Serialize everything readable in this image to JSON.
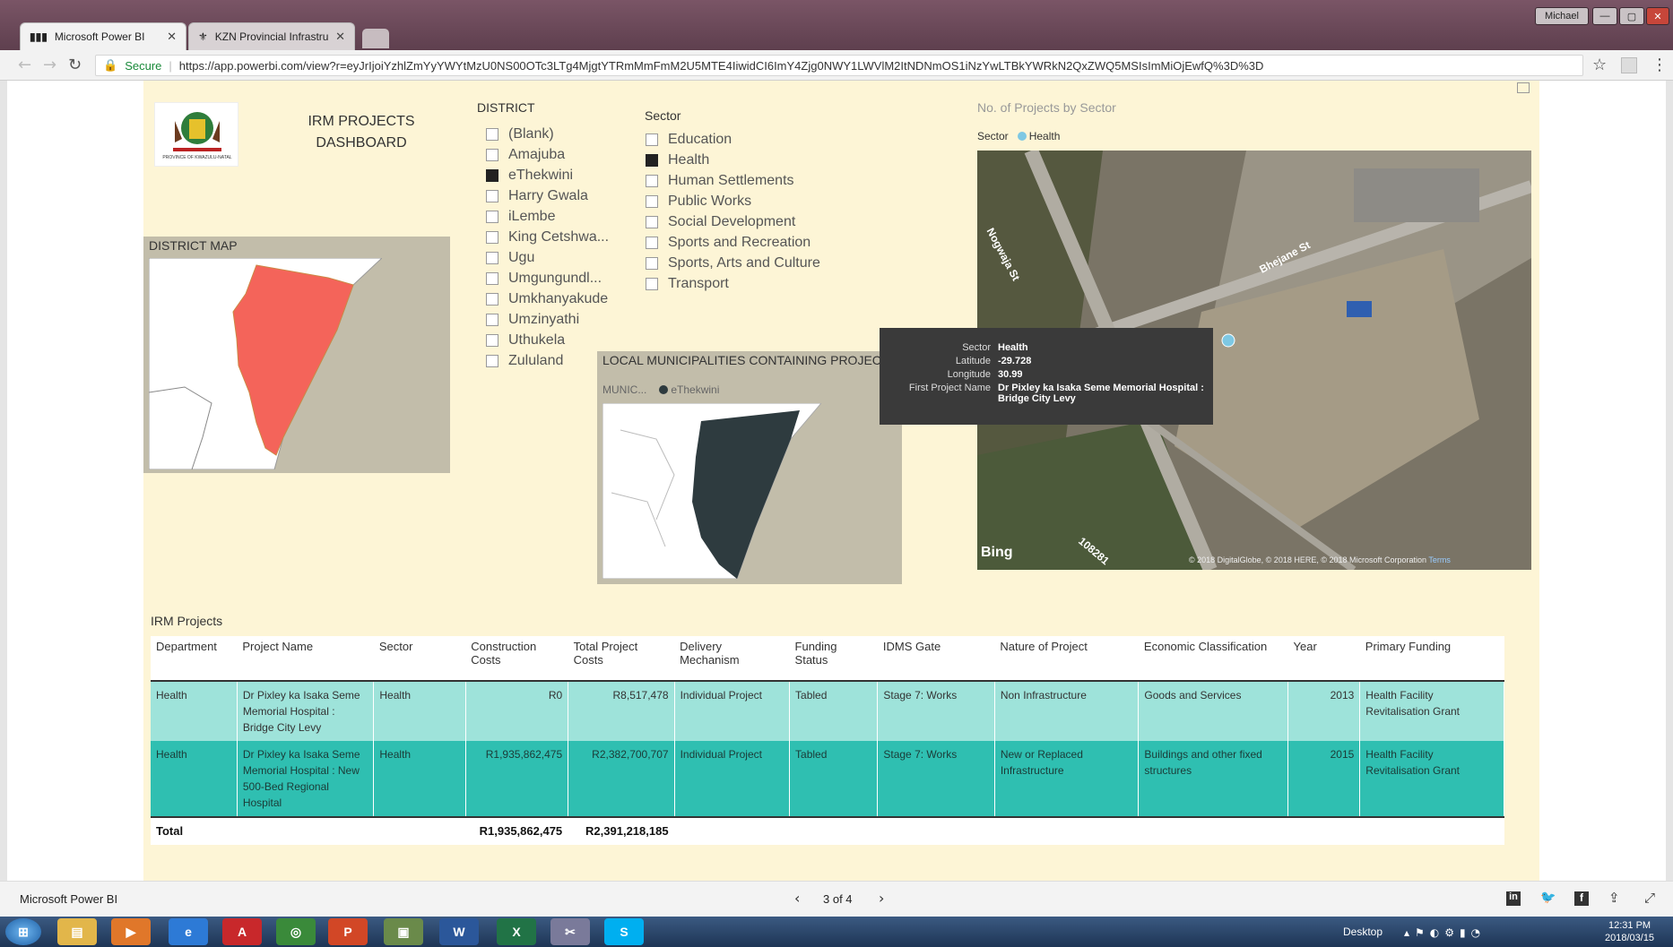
{
  "browser": {
    "tabs": [
      {
        "label": "Microsoft Power BI",
        "active": true
      },
      {
        "label": "KZN Provincial Infrastruc",
        "active": false
      }
    ],
    "user": "Michael",
    "secure_label": "Secure",
    "url": "https://app.powerbi.com/view?r=eyJrIjoiYzhlZmYyYWYtMzU0NS00OTc3LTg4MjgtYTRmMmFmM2U5MTE4IiwidCI6ImY4Zjg0NWY1LWVlM2ItNDNmOS1iNzYwLTBkYWRkN2QxZWQ5MSIsImMiOjEwfQ%3D%3D"
  },
  "dashboard": {
    "title_line1": "IRM PROJECTS",
    "title_line2": "DASHBOARD",
    "logo_text": "PROVINCE OF KWAZULU-NATAL",
    "district": {
      "heading": "DISTRICT",
      "items": [
        {
          "label": "(Blank)",
          "checked": false
        },
        {
          "label": "Amajuba",
          "checked": false
        },
        {
          "label": "eThekwini",
          "checked": true
        },
        {
          "label": "Harry Gwala",
          "checked": false
        },
        {
          "label": "iLembe",
          "checked": false
        },
        {
          "label": "King Cetshwa...",
          "checked": false
        },
        {
          "label": "Ugu",
          "checked": false
        },
        {
          "label": "Umgungundl...",
          "checked": false
        },
        {
          "label": "Umkhanyakude",
          "checked": false
        },
        {
          "label": "Umzinyathi",
          "checked": false
        },
        {
          "label": "Uthukela",
          "checked": false
        },
        {
          "label": "Zululand",
          "checked": false
        }
      ]
    },
    "sector": {
      "heading": "Sector",
      "items": [
        {
          "label": "Education",
          "checked": false
        },
        {
          "label": "Health",
          "checked": true
        },
        {
          "label": "Human Settlements",
          "checked": false
        },
        {
          "label": "Public Works",
          "checked": false
        },
        {
          "label": "Social Development",
          "checked": false
        },
        {
          "label": "Sports and Recreation",
          "checked": false
        },
        {
          "label": "Sports, Arts and Culture",
          "checked": false
        },
        {
          "label": "Transport",
          "checked": false
        }
      ]
    },
    "district_map": {
      "title": "DISTRICT MAP",
      "highlight_color": "#f4645a"
    },
    "muni_map": {
      "title": "LOCAL MUNICIPALITIES CONTAINING PROJECTS",
      "legend_label": "MUNIC...",
      "legend_item": "eThekwini",
      "color": "#2e3b3f"
    },
    "sector_map": {
      "title": "No. of Projects by Sector",
      "legend_label": "Sector",
      "legend_item": "Health",
      "legend_color": "#7ec8e3",
      "streets": [
        "Nogwaja St",
        "Bhejane St",
        "108281"
      ],
      "bing": "Bing",
      "attribution": "© 2018 DigitalGlobe, © 2018 HERE, © 2018 Microsoft Corporation",
      "terms": "Terms"
    },
    "tooltip": {
      "rows": [
        {
          "k": "Sector",
          "v": "Health"
        },
        {
          "k": "Latitude",
          "v": "-29.728"
        },
        {
          "k": "Longitude",
          "v": "30.99"
        },
        {
          "k": "First Project Name",
          "v": "Dr Pixley ka Isaka Seme Memorial Hospital : Bridge City Levy"
        }
      ]
    },
    "table": {
      "title": "IRM Projects",
      "columns": [
        "Department",
        "Project Name",
        "Sector",
        "Construction Costs",
        "Total Project Costs",
        "Delivery Mechanism",
        "Funding Status",
        "IDMS Gate",
        "Nature of Project",
        "Economic Classification",
        "Year",
        "Primary Funding"
      ],
      "rows": [
        [
          "Health",
          "Dr Pixley ka Isaka Seme Memorial Hospital : Bridge City Levy",
          "Health",
          "R0",
          "R8,517,478",
          "Individual Project",
          "Tabled",
          "Stage 7: Works",
          "Non Infrastructure",
          "Goods and Services",
          "2013",
          "Health Facility Revitalisation Grant"
        ],
        [
          "Health",
          "Dr Pixley ka Isaka Seme Memorial Hospital : New 500-Bed Regional Hospital",
          "Health",
          "R1,935,862,475",
          "R2,382,700,707",
          "Individual Project",
          "Tabled",
          "Stage 7: Works",
          "New or Replaced Infrastructure",
          "Buildings and other fixed structures",
          "2015",
          "Health Facility Revitalisation Grant"
        ]
      ],
      "total_label": "Total",
      "total_construction": "R1,935,862,475",
      "total_project": "R2,391,218,185"
    }
  },
  "status": {
    "app": "Microsoft Power BI",
    "pager": "3 of 4"
  },
  "taskbar": {
    "desktop": "Desktop",
    "time": "12:31 PM",
    "date": "2018/03/15"
  }
}
